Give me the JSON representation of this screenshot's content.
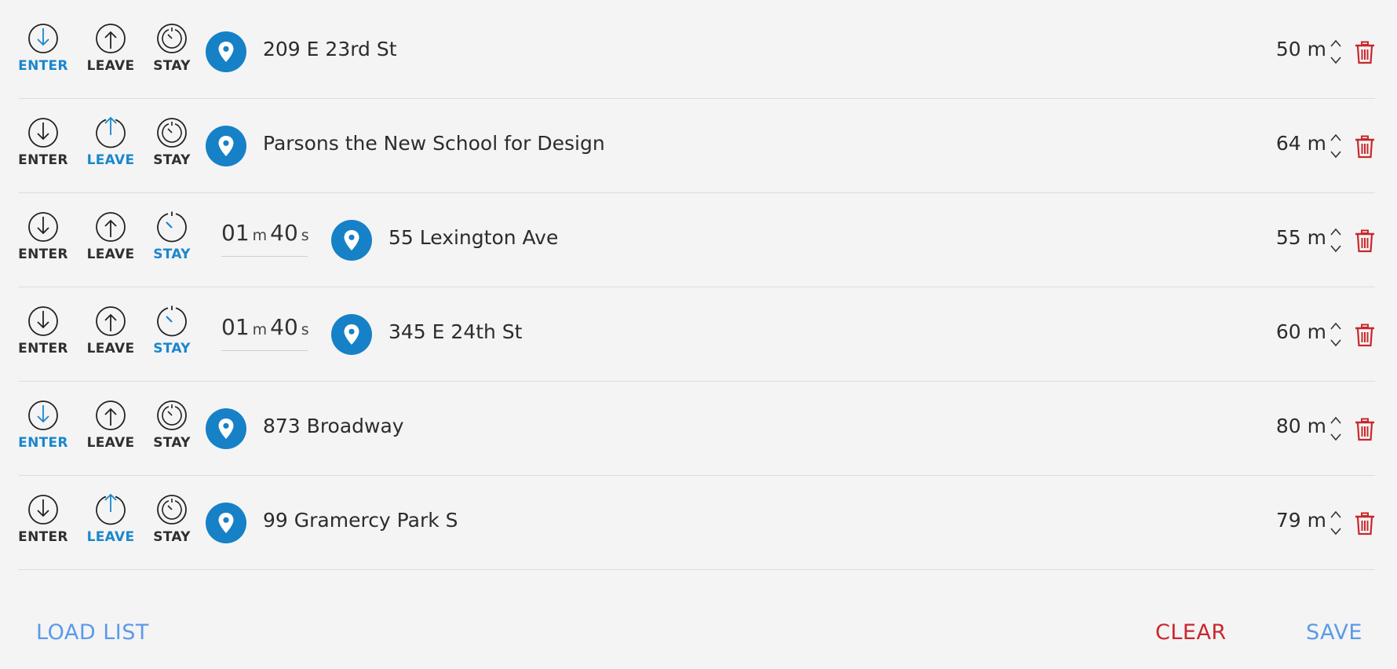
{
  "labels": {
    "enter": "ENTER",
    "leave": "LEAVE",
    "stay": "STAY",
    "min_unit": "m",
    "sec_unit": "s"
  },
  "colors": {
    "active": "#1a87cc",
    "pin": "#1681c6",
    "danger": "#c9272b",
    "link": "#5b9ae8"
  },
  "rows": [
    {
      "trigger": "enter",
      "address": "209 E 23rd St",
      "radius": "50 m"
    },
    {
      "trigger": "leave",
      "address": "Parsons the New School for Design",
      "radius": "64 m"
    },
    {
      "trigger": "stay",
      "minutes": "01",
      "seconds": "40",
      "address": "55 Lexington Ave",
      "radius": "55 m"
    },
    {
      "trigger": "stay",
      "minutes": "01",
      "seconds": "40",
      "address": "345 E 24th St",
      "radius": "60 m"
    },
    {
      "trigger": "enter",
      "address": "873 Broadway",
      "radius": "80 m"
    },
    {
      "trigger": "leave",
      "address": "99 Gramercy Park S",
      "radius": "79 m"
    }
  ],
  "footer": {
    "load_list": "LOAD LIST",
    "clear": "CLEAR",
    "save": "SAVE"
  }
}
